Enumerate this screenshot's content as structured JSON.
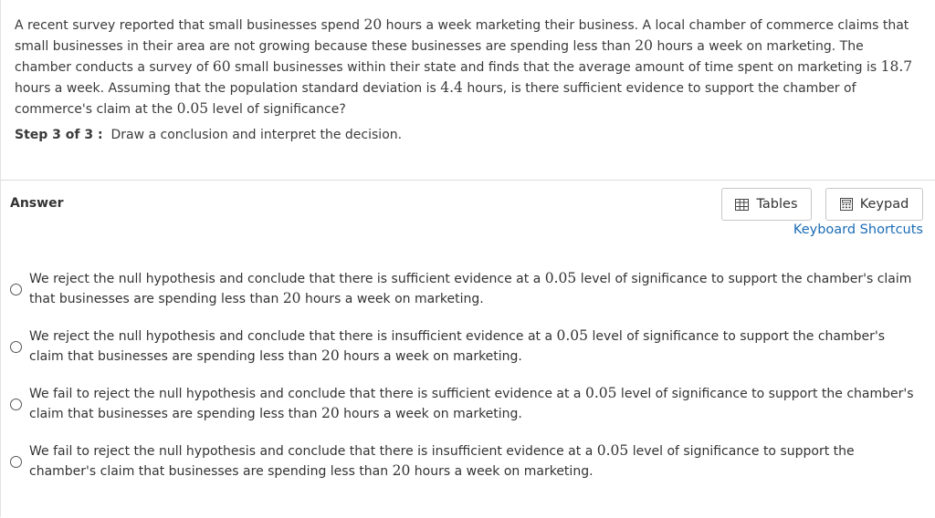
{
  "question": {
    "segments": [
      "A recent survey reported that small businesses spend ",
      "20",
      " hours a week marketing their business. A local chamber of commerce claims that small businesses in their area are not growing because these businesses are spending less than ",
      "20",
      " hours a week on marketing. The chamber conducts a survey of ",
      "60",
      " small businesses within their state and finds that the average amount of time spent on marketing is ",
      "18.7",
      " hours a week. Assuming that the population standard deviation is ",
      "4.4",
      " hours, is there sufficient evidence to support the chamber of commerce's claim at the ",
      "0.05",
      " level of significance?"
    ]
  },
  "step": {
    "label": "Step 3 of 3 :",
    "text": "Draw a conclusion and interpret the decision."
  },
  "answer_label": "Answer",
  "tools": {
    "tables_label": "Tables",
    "keypad_label": "Keypad",
    "shortcuts_label": "Keyboard Shortcuts",
    "tables_icon": "table-grid-icon",
    "keypad_icon": "keypad-icon",
    "link_color": "#1a6cb5"
  },
  "options": [
    {
      "segments": [
        "We reject the null hypothesis and conclude that there is sufficient evidence at a ",
        "0.05",
        " level of significance to support the chamber's claim that businesses are spending less than ",
        "20",
        " hours a week on marketing."
      ]
    },
    {
      "segments": [
        "We reject the null hypothesis and conclude that there is insufficient evidence at a ",
        "0.05",
        " level of significance to support the chamber's claim that businesses are spending less than ",
        "20",
        " hours a week on marketing."
      ]
    },
    {
      "segments": [
        "We fail to reject the null hypothesis and conclude that there is sufficient evidence at a ",
        "0.05",
        " level of significance to support the chamber's claim that businesses are spending less than ",
        "20",
        " hours a week on marketing."
      ]
    },
    {
      "segments": [
        "We fail to reject the null hypothesis and conclude that there is insufficient evidence at a ",
        "0.05",
        " level of significance to support the chamber's claim that businesses are spending less than ",
        "20",
        " hours a week on marketing."
      ]
    }
  ]
}
